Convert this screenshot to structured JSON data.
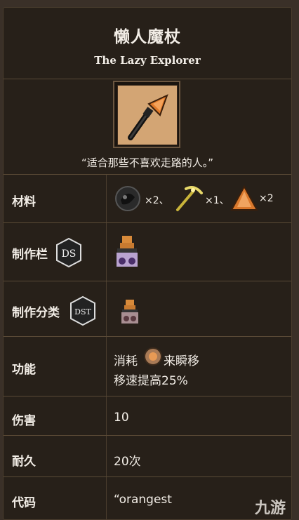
{
  "item": {
    "name": "懒人魔杖",
    "english_name": "The Lazy Explorer",
    "quote": "“适合那些不喜欢走路的人。”"
  },
  "recipe": {
    "label": "材料",
    "ingredients": [
      {
        "icon": "nightmare-fuel-icon",
        "count": "×2、"
      },
      {
        "icon": "golden-pickaxe-icon",
        "count": "×1、"
      },
      {
        "icon": "orange-gem-icon",
        "count": "×2"
      }
    ]
  },
  "craft_tab": {
    "label": "制作栏",
    "badge": "DS",
    "station_icon": "ancient-altar-icon"
  },
  "craft_category": {
    "label": "制作分类",
    "badge": "DST",
    "station_icon": "ancient-altar-small-icon"
  },
  "function": {
    "label": "功能",
    "line1_before": "消耗",
    "line1_after": "来瞬移",
    "line2": "移速提高25%"
  },
  "damage": {
    "label": "伤害",
    "value": "10"
  },
  "durability": {
    "label": "耐久",
    "value": "20次"
  },
  "code": {
    "label": "代码",
    "value": "“orangest"
  },
  "watermark": "九游",
  "colors": {
    "background": "#272019",
    "border": "#5a4a36",
    "text": "#f2ede6"
  }
}
